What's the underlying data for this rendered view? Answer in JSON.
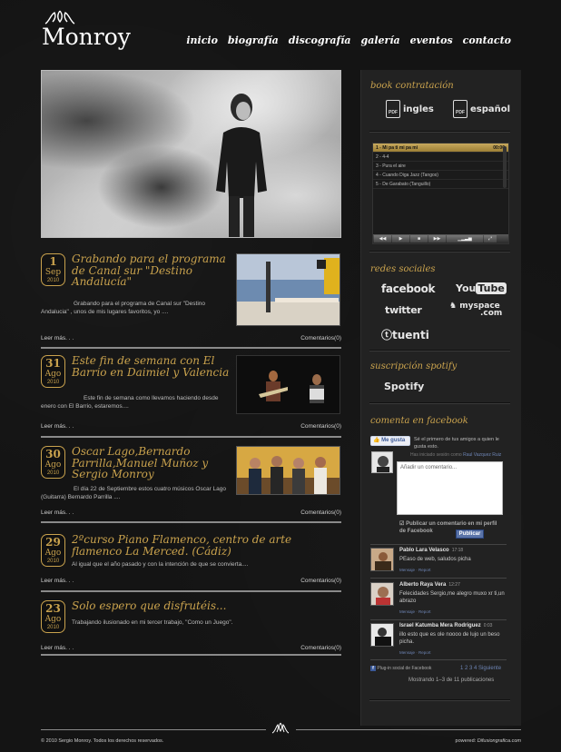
{
  "logo": {
    "text": "Monroy"
  },
  "nav": [
    "inicio",
    "biografía",
    "discografía",
    "galería",
    "eventos",
    "contacto"
  ],
  "posts": [
    {
      "day": "1",
      "month": "Sep",
      "year": "2010",
      "title": "Grabando para el programa de Canal sur \"Destino Andalucía\"",
      "excerpt": "Grabando para el programa de Canal sur \"Destino Andalucia\" , unos de mis lugares favoritos, yo ....",
      "more": "Leer más. . .",
      "comments": "Comentarios(0)"
    },
    {
      "day": "31",
      "month": "Ago",
      "year": "2010",
      "title": "Este fin de semana con El Barrio en Daimiel y Valencia",
      "excerpt": "Este fin de semana como llevamos  haciendo desde enero con El Barrio, estaremos....",
      "more": "Leer más. . .",
      "comments": "Comentarios(0)"
    },
    {
      "day": "30",
      "month": "Ago",
      "year": "2010",
      "title": "Oscar Lago,Bernardo Parrilla,Manuel Muñoz y Sergio Monroy",
      "excerpt": "El día 22 de Septiembre estos cuatro músicos Oscar Lago (Guitarra) Bernardo Parrilla ....",
      "more": "Leer más. . .",
      "comments": "Comentarios(0)"
    },
    {
      "day": "29",
      "month": "Ago",
      "year": "2010",
      "title": "2ºcurso Piano Flamenco, centro de arte flamenco La Merced. (Cádiz)",
      "excerpt": "Al igual que el año pasado y con la intención de que se convierta....",
      "more": "Leer más. . .",
      "comments": "Comentarios(0)"
    },
    {
      "day": "23",
      "month": "Ago",
      "year": "2010",
      "title": "Solo espero que disfrutéis...",
      "excerpt": "Trabajando ilusionado en mi tercer trabajo, \"Como un Juego\".",
      "more": "Leer más. . .",
      "comments": "Comentarios(0)"
    }
  ],
  "sidebar": {
    "book_title": "book contratación",
    "pdf_labels": [
      "ingles",
      "español"
    ],
    "pdf_icon_text": "PDF",
    "player": {
      "tracks": [
        "1 - Mi pa ti mi pa mi",
        "2 - 4-4",
        "3 - Pura el aire",
        "4 - Cuando Diga Jazz (Tangos)",
        "5 - De Garabato (Tanguillo)"
      ],
      "current_time": "00:00"
    },
    "social_title": "redes sociales",
    "social": {
      "facebook": "facebook",
      "youtube_you": "You",
      "youtube_tube": "Tube",
      "twitter": "twitter",
      "myspace": "myspace",
      "myspace_com": ".com",
      "tuenti": "tuenti"
    },
    "spotify_title": "suscripción spotify",
    "spotify": "Spotify",
    "facebook_title": "comenta en facebook"
  },
  "fb": {
    "like": "Me gusta",
    "like_text": "Sé el primero de tus amigos a quien le gusta esto.",
    "user_prefix": "Has iniciado sesión como",
    "user_name": "Raul Vazquez Ruiz",
    "placeholder": "Añadir un comentario...",
    "post_label": "Publicar un comentario en mi perfil de Facebook",
    "publish": "Publicar",
    "comments": [
      {
        "name": "Pablo Lara Velasco",
        "time": "17:18",
        "text": "PEaso de web, saludos picha",
        "meta": "Mensaje · Report"
      },
      {
        "name": "Alberto Raya Vera",
        "time": "12:27",
        "text": "Felecidades Sergio,me alegro muxo xr ti,un abrazo",
        "meta": "Mensaje · Report"
      },
      {
        "name": "Israel Katumba Mera Rodriguez",
        "time": "0:03",
        "text": "illo esto que es ole noooo de lujo un beso picha.",
        "meta": "Mensaje · Report"
      }
    ],
    "plugin": "Plug-in social de Facebook",
    "pages": "1  2  3  4  Siguiente",
    "showing": "Mostrando 1–3 de 11 publicaciones"
  },
  "footer": {
    "left": "© 2010 Sergio Monroy. Todos los derechos reservados.",
    "right_prefix": "powered:",
    "right_brand": "Difusiongrafica.com"
  }
}
